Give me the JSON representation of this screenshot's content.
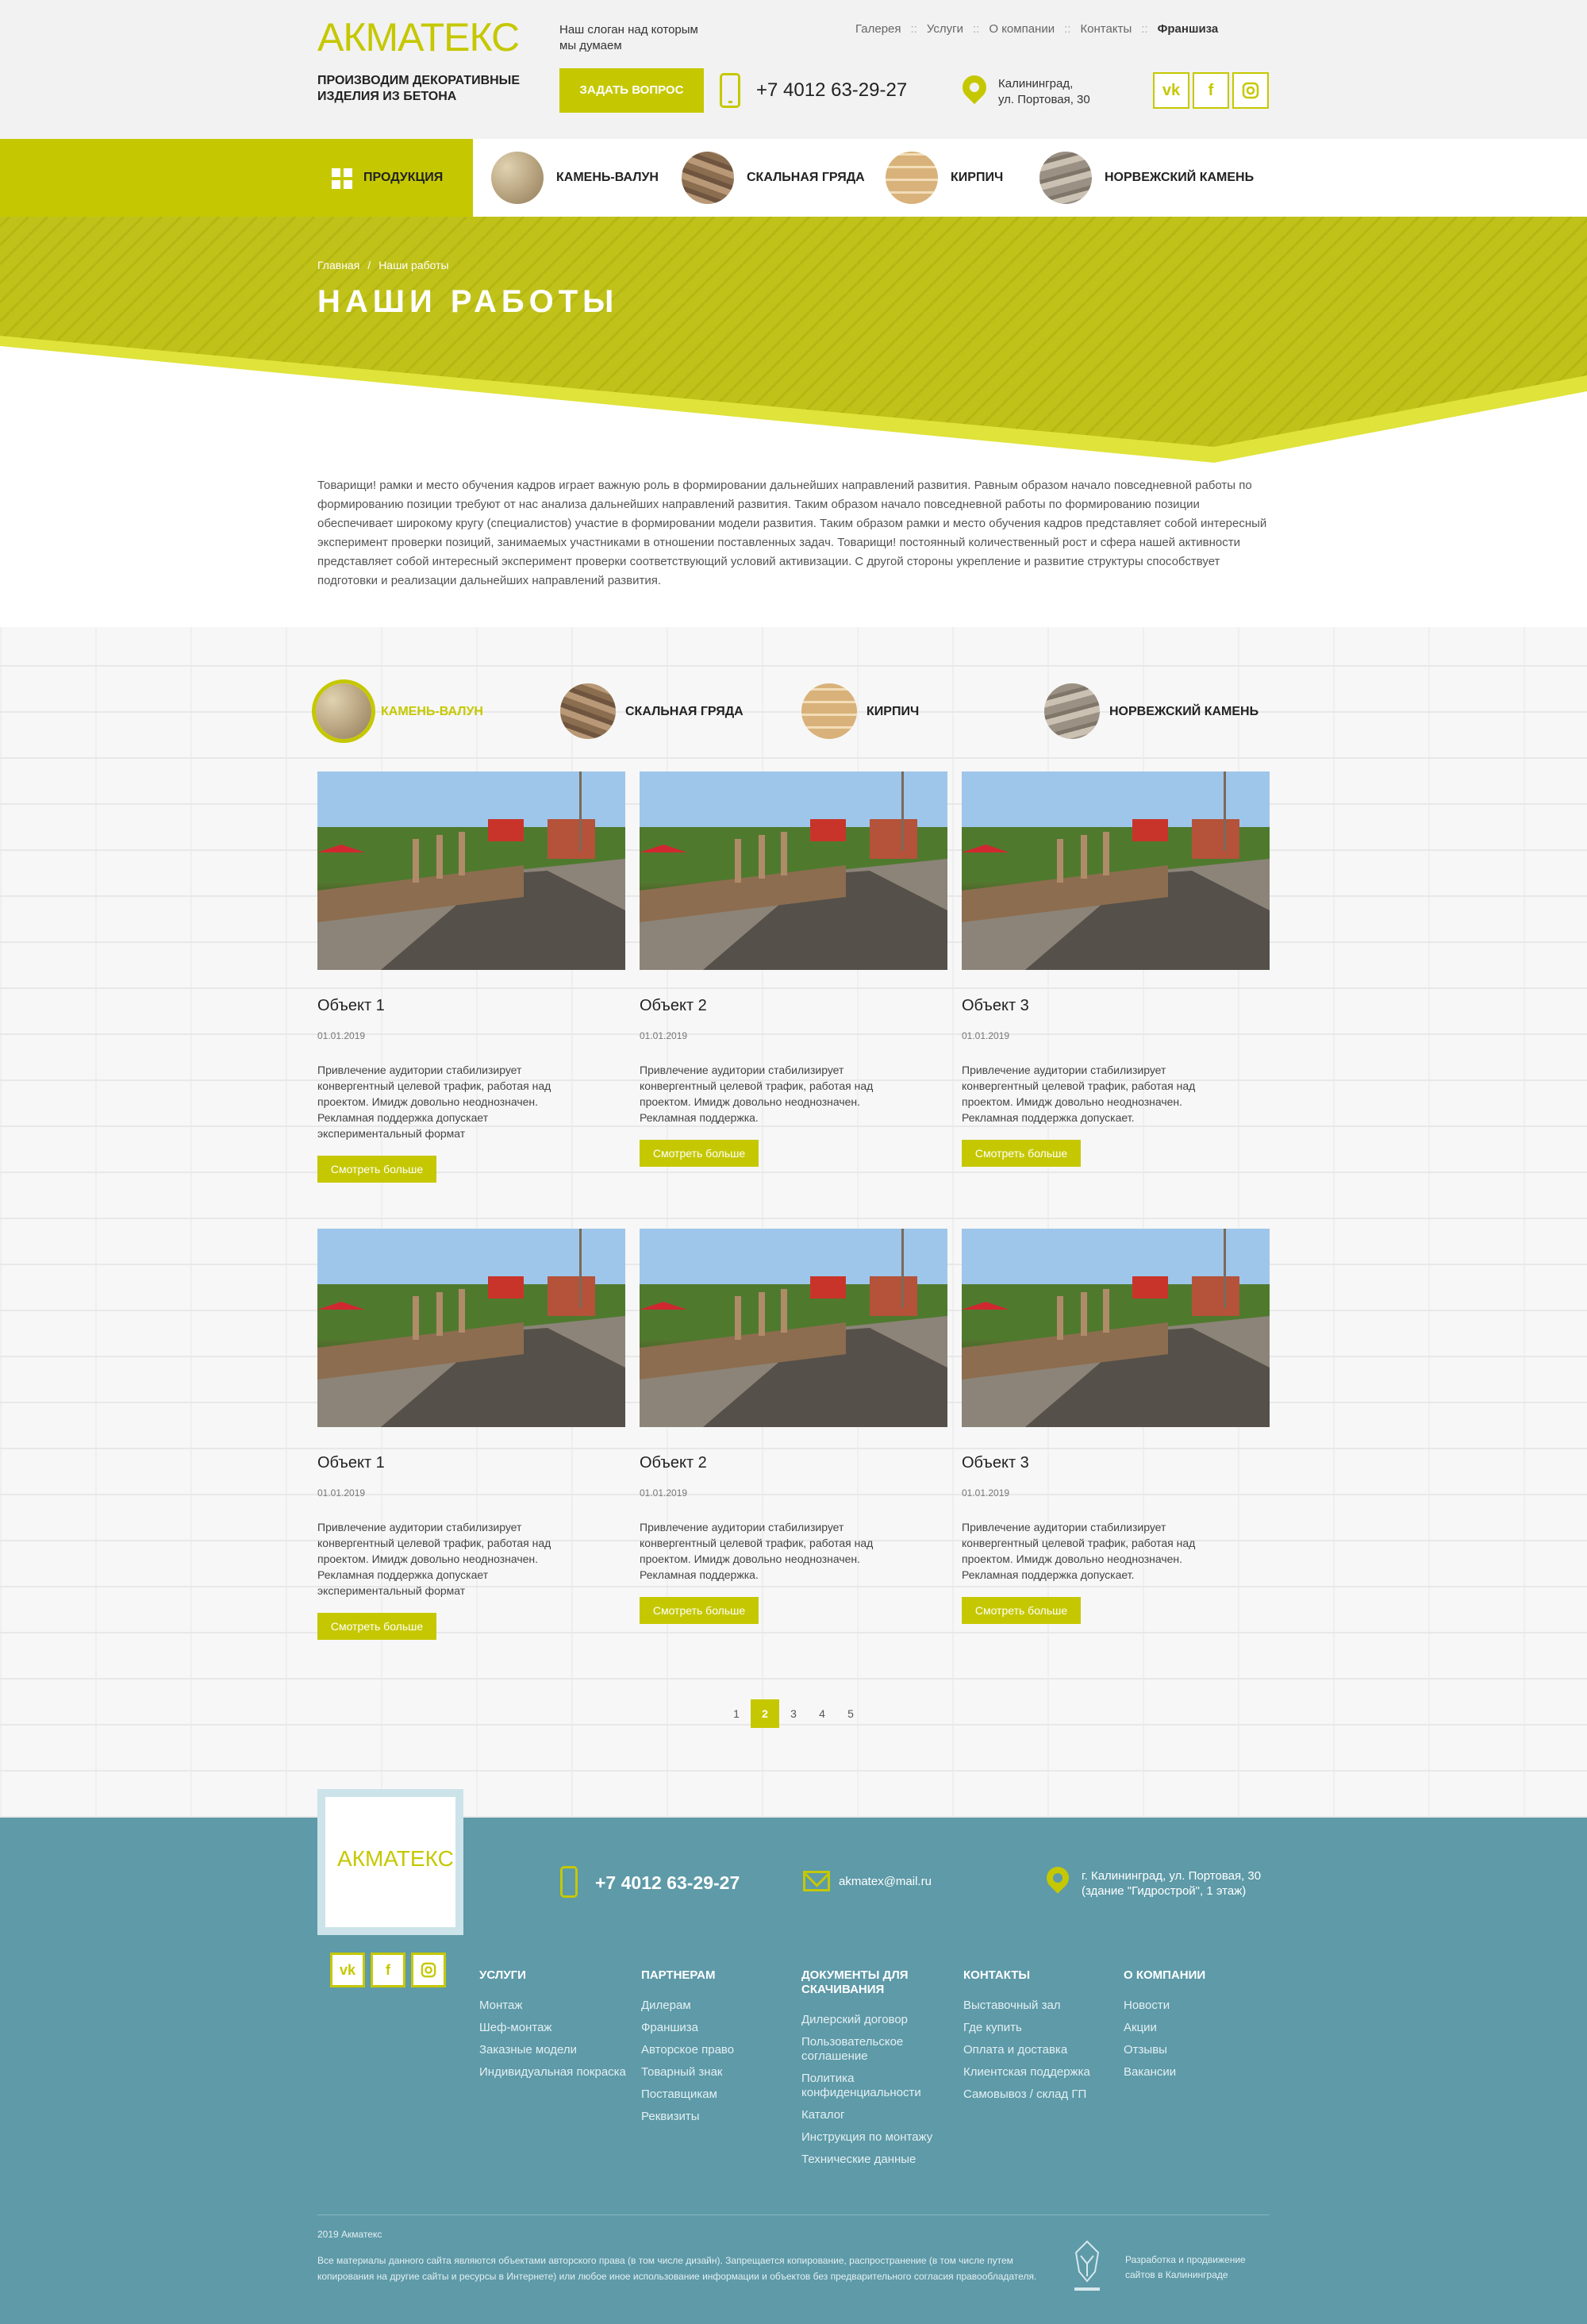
{
  "header": {
    "logo": "АКМАТЕКС",
    "slogan": "Наш слоган над которым мы думаем",
    "nav": [
      {
        "label": "Галерея"
      },
      {
        "label": "Услуги"
      },
      {
        "label": "О компании"
      },
      {
        "label": "Контакты"
      },
      {
        "label": "Франшиза"
      }
    ],
    "nav_separator": "::",
    "tagline": "ПРОИЗВОДИМ ДЕКОРАТИВНЫЕ ИЗДЕЛИЯ ИЗ БЕТОНА",
    "ask_button": "ЗАДАТЬ ВОПРОС",
    "phone": "+7 4012 63-29-27",
    "address_line1": "Калининград,",
    "address_line2": "ул. Портовая, 30",
    "social": [
      "vk",
      "f",
      "ig"
    ]
  },
  "product_nav": {
    "main_label": "ПРОДУКЦИЯ",
    "items": [
      {
        "label": "КАМЕНЬ-ВАЛУН"
      },
      {
        "label": "СКАЛЬНАЯ ГРЯДА"
      },
      {
        "label": "КИРПИЧ"
      },
      {
        "label": "НОРВЕЖСКИЙ КАМЕНЬ"
      }
    ]
  },
  "breadcrumb": {
    "home": "Главная",
    "separator": "/",
    "current": "Наши работы"
  },
  "page_title": "НАШИ РАБОТЫ",
  "intro": "Товарищи! рамки и место обучения кадров играет важную роль в формировании дальнейших направлений развития. Равным образом начало повседневной работы по формированию позиции требуют от нас анализа дальнейших направлений развития. Таким образом начало повседневной работы по формированию позиции обеспечивает широкому кругу (специалистов) участие в формировании модели развития. Таким образом рамки и место обучения кадров представляет собой интересный эксперимент проверки позиций, занимаемых участниками в отношении поставленных задач. Товарищи! постоянный количественный рост и сфера нашей активности представляет собой интересный эксперимент проверки соответствующий условий активизации. С другой стороны укрепление и развитие структуры способствует подготовки и реализации дальнейших направлений развития.",
  "filters": [
    {
      "label": "КАМЕНЬ-ВАЛУН",
      "active": true
    },
    {
      "label": "СКАЛЬНАЯ ГРЯДА",
      "active": false
    },
    {
      "label": "КИРПИЧ",
      "active": false
    },
    {
      "label": "НОРВЕЖСКИЙ КАМЕНЬ",
      "active": false
    }
  ],
  "cards": [
    {
      "title": "Объект 1",
      "date": "01.01.2019",
      "text": "Привлечение аудитории стабилизирует конвергентный целевой трафик, работая над проектом. Имидж довольно неоднозначен. Рекламная поддержка допускает экспериментальный формат",
      "button": "Смотреть больше"
    },
    {
      "title": "Объект 2",
      "date": "01.01.2019",
      "text": "Привлечение аудитории стабилизирует конвергентный целевой трафик, работая над проектом. Имидж довольно неоднозначен. Рекламная поддержка.",
      "button": "Смотреть больше"
    },
    {
      "title": "Объект 3",
      "date": "01.01.2019",
      "text": "Привлечение аудитории стабилизирует конвергентный целевой трафик, работая над проектом. Имидж довольно неоднозначен. Рекламная поддержка допускает.",
      "button": "Смотреть больше"
    },
    {
      "title": "Объект 1",
      "date": "01.01.2019",
      "text": "Привлечение аудитории стабилизирует конвергентный целевой трафик, работая над проектом. Имидж довольно неоднозначен. Рекламная поддержка допускает экспериментальный формат",
      "button": "Смотреть больше"
    },
    {
      "title": "Объект 2",
      "date": "01.01.2019",
      "text": "Привлечение аудитории стабилизирует конвергентный целевой трафик, работая над проектом. Имидж довольно неоднозначен. Рекламная поддержка.",
      "button": "Смотреть больше"
    },
    {
      "title": "Объект 3",
      "date": "01.01.2019",
      "text": "Привлечение аудитории стабилизирует конвергентный целевой трафик, работая над проектом. Имидж довольно неоднозначен. Рекламная поддержка допускает.",
      "button": "Смотреть больше"
    }
  ],
  "pagination": {
    "pages": [
      "1",
      "2",
      "3",
      "4",
      "5"
    ],
    "current": "2"
  },
  "footer": {
    "logo": "АКМАТЕКС",
    "phone": "+7 4012 63-29-27",
    "email": "akmatex@mail.ru",
    "address_line1": "г. Калининград, ул. Портовая, 30",
    "address_line2": "(здание \"Гидрострой\", 1 этаж)",
    "columns": [
      {
        "heading": "УСЛУГИ",
        "links": [
          "Монтаж",
          "Шеф-монтаж",
          "Заказные модели",
          "Индивидуальная покраска"
        ]
      },
      {
        "heading": "ПАРТНЕРАМ",
        "links": [
          "Дилерам",
          "Франшиза",
          "Авторское право",
          "Товарный знак",
          "Поставщикам",
          "Реквизиты"
        ]
      },
      {
        "heading": "ДОКУМЕНТЫ ДЛЯ СКАЧИВАНИЯ",
        "links": [
          "Дилерский договор",
          "Пользовательское соглашение",
          "Политика конфиденциальности",
          "Каталог",
          "Инструкция по монтажу",
          "Технические данные"
        ]
      },
      {
        "heading": "КОНТАКТЫ",
        "links": [
          "Выставочный зал",
          "Где купить",
          "Оплата и доставка",
          "Клиентская поддержка",
          "Самовывоз / склад ГП"
        ]
      },
      {
        "heading": "О КОМПАНИИ",
        "links": [
          "Новости",
          "Акции",
          "Отзывы",
          "Вакансии"
        ]
      }
    ],
    "copyright": "2019 Акматекс",
    "legal": "Все материалы данного сайта являются объектами авторского права (в том числе дизайн). Запрещается копирование, распространение (в том числе путем копирования на другие сайты и ресурсы в Интернете) или любое иное использование информации и объектов без предварительного согласия правообладателя.",
    "developer": "Разработка и продвижение сайтов в Калининграде"
  },
  "colors": {
    "accent": "#c5c800",
    "footer_bg": "#5e9aa8",
    "header_bg": "#f2f2f2"
  }
}
